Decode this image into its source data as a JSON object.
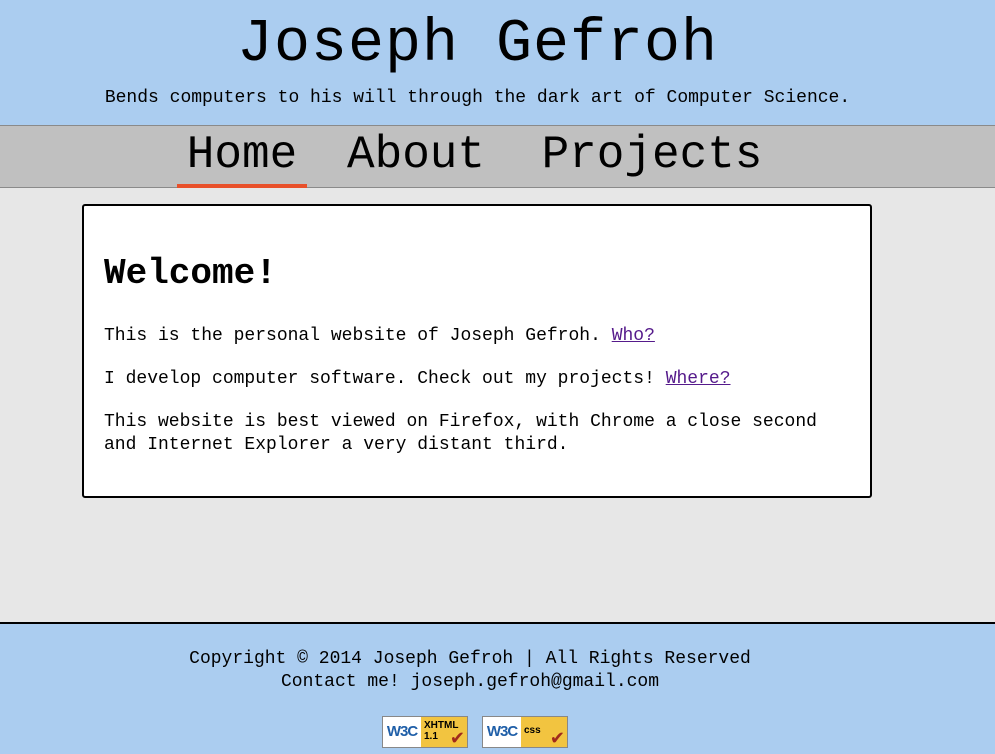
{
  "header": {
    "title": "Joseph Gefroh",
    "tagline": "Bends computers to his will through the dark art of Computer Science."
  },
  "nav": {
    "items": [
      {
        "label": "Home",
        "active": true
      },
      {
        "label": "About",
        "active": false
      },
      {
        "label": "Projects",
        "active": false
      }
    ],
    "active_underline_color": "#e8502a"
  },
  "main": {
    "heading": "Welcome!",
    "para1_text": "This is the personal website of Joseph Gefroh. ",
    "para1_link": "Who?",
    "para2_text": "I develop computer software. Check out my projects! ",
    "para2_link": "Where?",
    "para3_text": "This website is best viewed on Firefox, with Chrome a close second and Internet Explorer a very distant third."
  },
  "footer": {
    "copyright": "Copyright © 2014 Joseph Gefroh | All Rights Reserved",
    "contact": "Contact me! joseph.gefroh@gmail.com",
    "badges": [
      {
        "logo": "W3C",
        "label1": "XHTML",
        "label2": "1.1",
        "icon": "checkmark-icon"
      },
      {
        "logo": "W3C",
        "label1": "css",
        "label2": "",
        "icon": "checkmark-icon"
      }
    ]
  },
  "colors": {
    "header_bg": "#abcdf0",
    "nav_bg": "#c0c0c0",
    "page_bg": "#e7e7e7",
    "link": "#551a8b"
  }
}
